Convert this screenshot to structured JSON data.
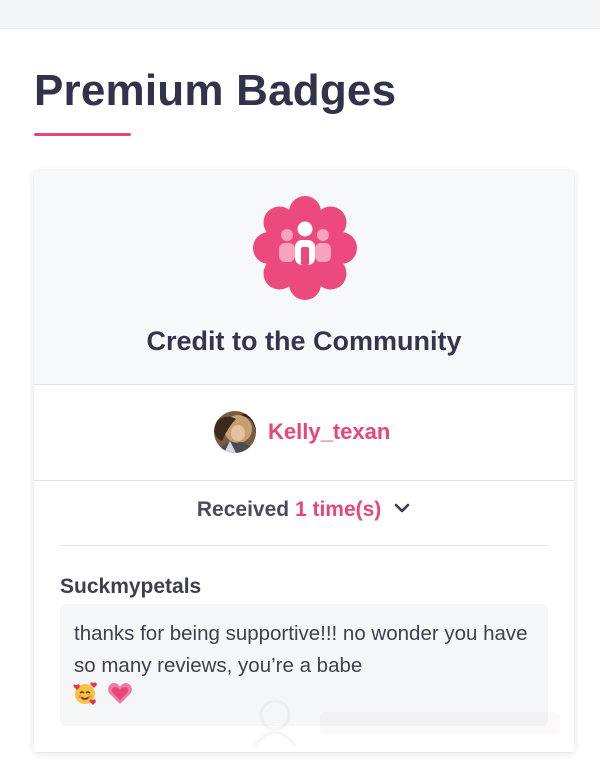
{
  "page": {
    "title": "Premium Badges",
    "accent_color": "#e8457a",
    "text_color": "#32324a"
  },
  "badge": {
    "name": "Credit to the Community",
    "icon": "community-group-icon",
    "icon_color": "#ec4a7e"
  },
  "recipient": {
    "username": "Kelly_texan",
    "avatar": "user-avatar-photo"
  },
  "received": {
    "label": "Received",
    "count_text": "1 time(s)",
    "toggle_icon": "chevron-down-icon"
  },
  "comment": {
    "author": "Suckmypetals",
    "message": "thanks for being supportive!!! no wonder you have so many reviews, you’re a babe",
    "emojis": [
      "smiling-face-with-hearts-emoji",
      "growing-heart-emoji"
    ]
  }
}
